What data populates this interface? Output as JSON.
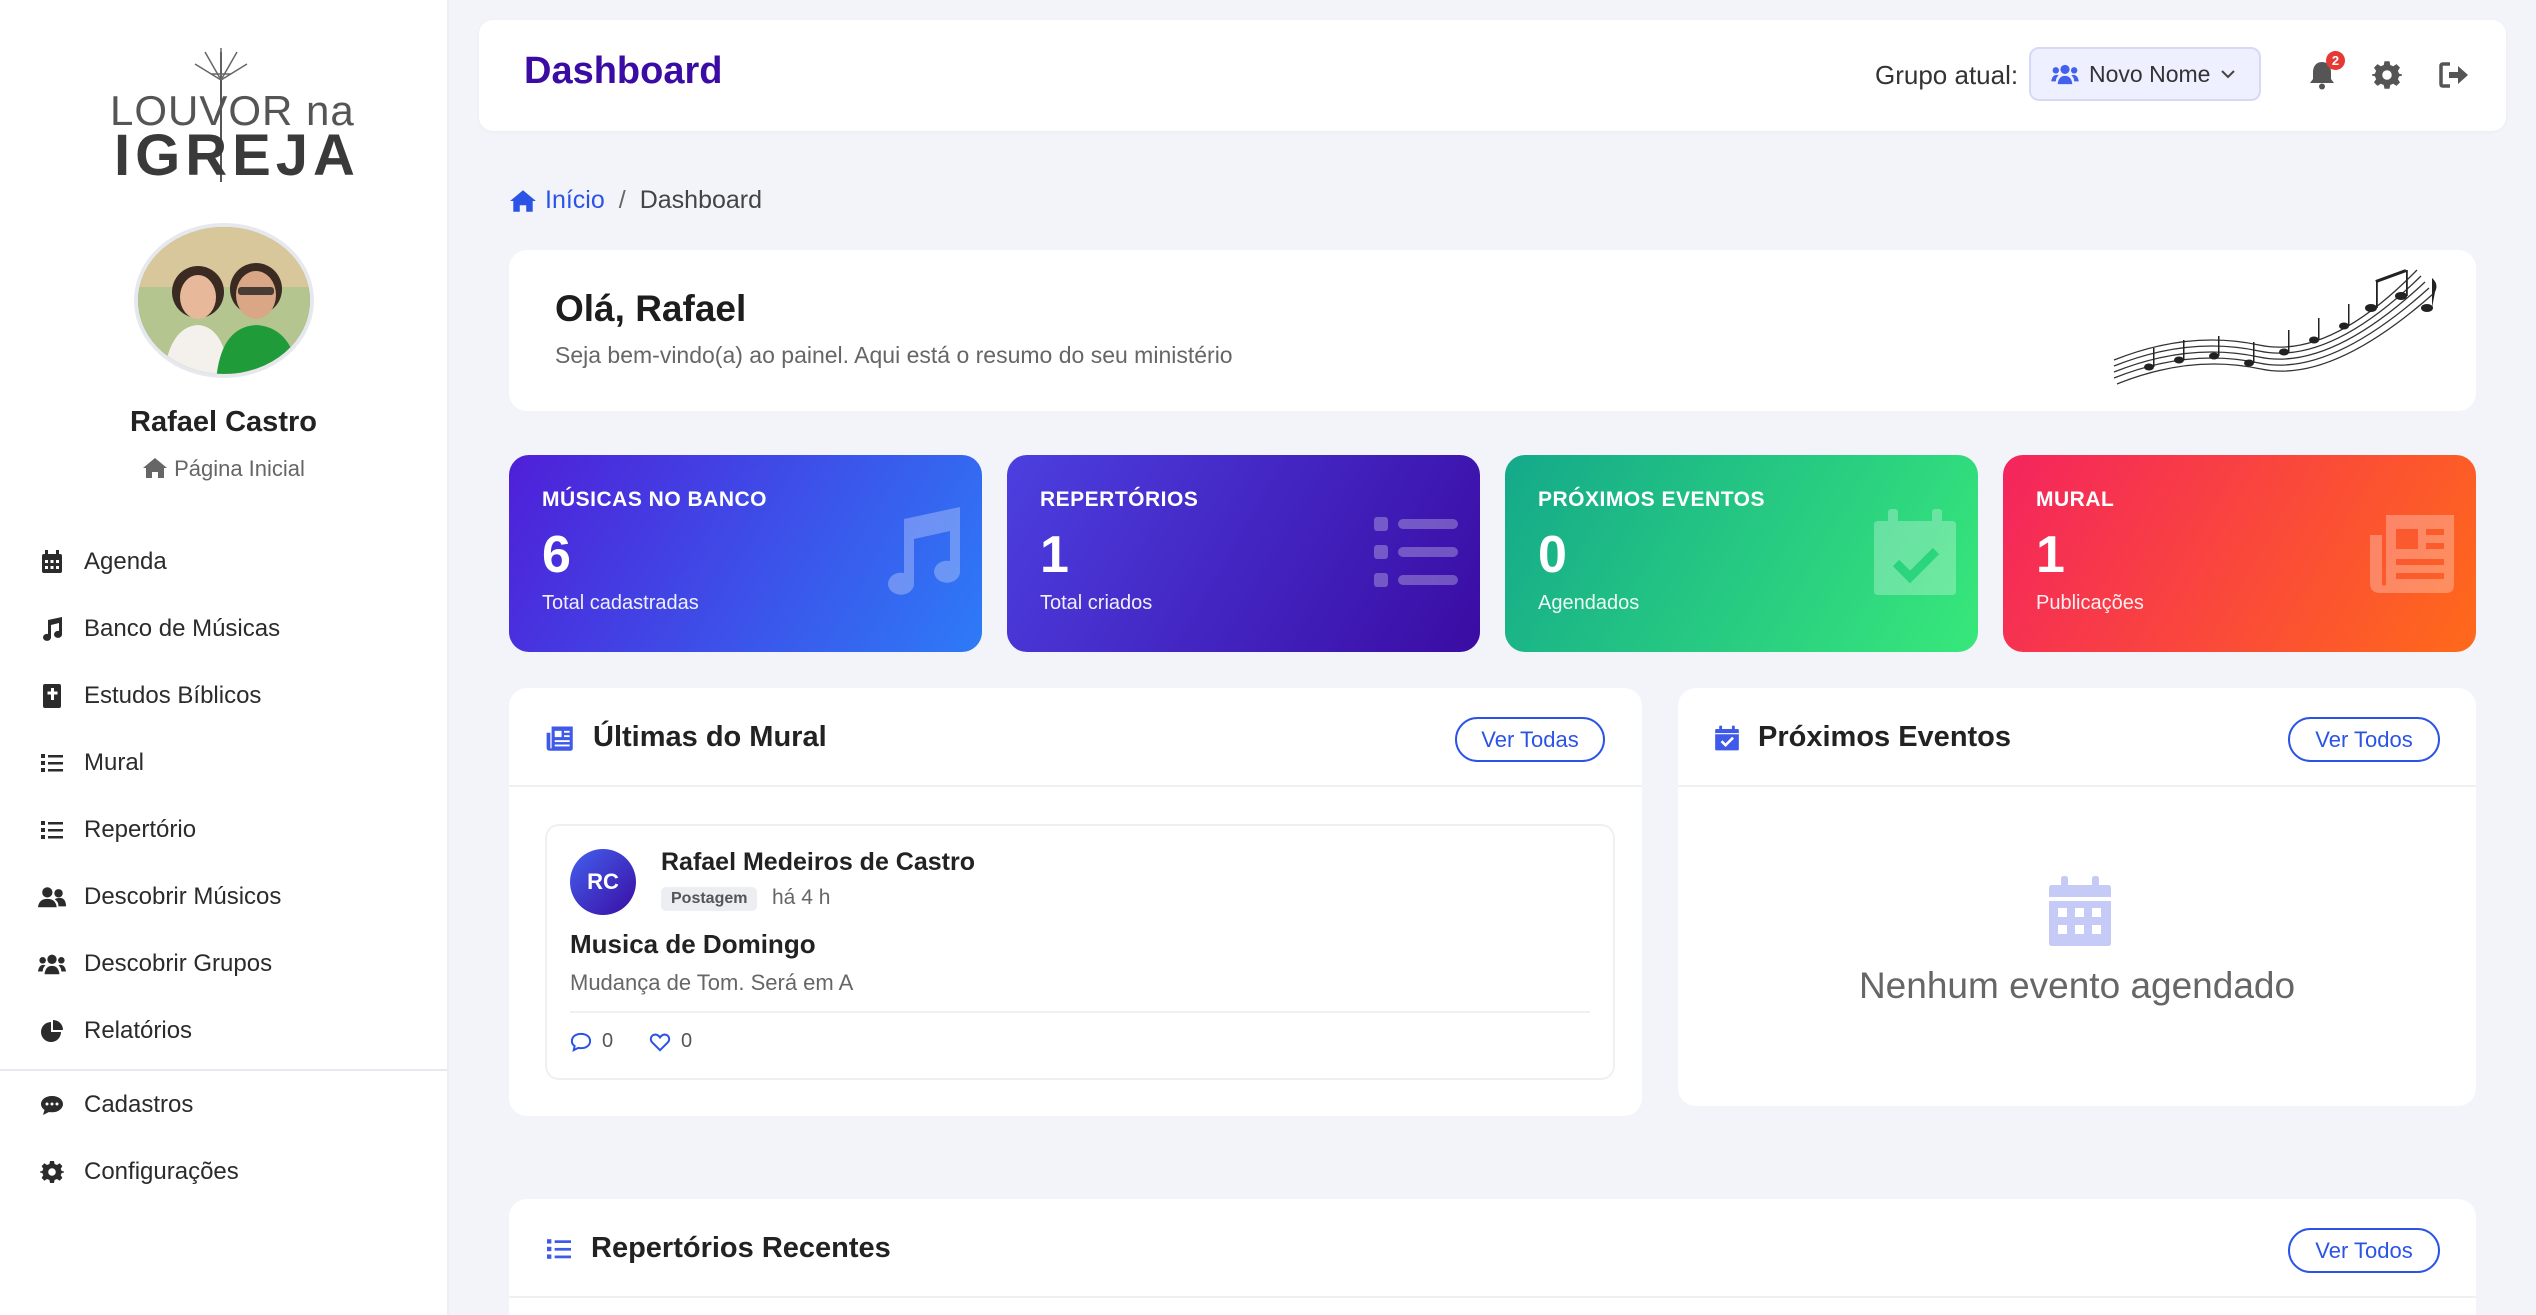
{
  "sidebar": {
    "logo": {
      "line1": "LOUVOR na",
      "line2": "IGREJA"
    },
    "user": {
      "name": "Rafael Castro",
      "home_label": "Página Inicial"
    },
    "items": [
      {
        "label": "Agenda",
        "icon": "calendar-icon"
      },
      {
        "label": "Banco de Músicas",
        "icon": "music-note-icon"
      },
      {
        "label": "Estudos Bíblicos",
        "icon": "bible-icon"
      },
      {
        "label": "Mural",
        "icon": "list-icon"
      },
      {
        "label": "Repertório",
        "icon": "list-icon"
      },
      {
        "label": "Descobrir Músicos",
        "icon": "users-icon"
      },
      {
        "label": "Descobrir Grupos",
        "icon": "group-icon"
      },
      {
        "label": "Relatórios",
        "icon": "pie-chart-icon"
      },
      {
        "label": "Cadastros",
        "icon": "comment-icon"
      },
      {
        "label": "Configurações",
        "icon": "gear-icon"
      }
    ]
  },
  "topbar": {
    "title": "Dashboard",
    "group_label": "Grupo atual:",
    "group_value": "Novo Nome",
    "notification_count": "2"
  },
  "breadcrumb": {
    "home": "Início",
    "current": "Dashboard"
  },
  "welcome": {
    "title": "Olá, Rafael",
    "subtitle": "Seja bem-vindo(a) ao painel. Aqui está o resumo do seu ministério"
  },
  "stats": [
    {
      "label": "MÚSICAS NO BANCO",
      "value": "6",
      "sub": "Total cadastradas",
      "icon": "music-icon"
    },
    {
      "label": "REPERTÓRIOS",
      "value": "1",
      "sub": "Total criados",
      "icon": "list-icon"
    },
    {
      "label": "PRÓXIMOS EVENTOS",
      "value": "0",
      "sub": "Agendados",
      "icon": "calendar-check-icon"
    },
    {
      "label": "MURAL",
      "value": "1",
      "sub": "Publicações",
      "icon": "newspaper-icon"
    }
  ],
  "colors": {
    "accent": "#3a0ca3",
    "link": "#2b54e6",
    "stat1": [
      "#4f1fd8",
      "#2d7bf7"
    ],
    "stat2": [
      "#4c3fe0",
      "#3a0ca3"
    ],
    "stat3": [
      "#14a98a",
      "#38e87a"
    ],
    "stat4": [
      "#f4245e",
      "#ff6a1a"
    ]
  },
  "mural": {
    "title": "Últimas do Mural",
    "button": "Ver Todas",
    "post": {
      "initials": "RC",
      "author": "Rafael Medeiros de Castro",
      "tag": "Postagem",
      "time": "há 4 h",
      "title": "Musica de Domingo",
      "body": "Mudança de Tom. Será em A",
      "comments": "0",
      "likes": "0"
    }
  },
  "events": {
    "title": "Próximos Eventos",
    "button": "Ver Todos",
    "empty": "Nenhum evento agendado"
  },
  "repertorios": {
    "title": "Repertórios Recentes",
    "button": "Ver Todos"
  }
}
